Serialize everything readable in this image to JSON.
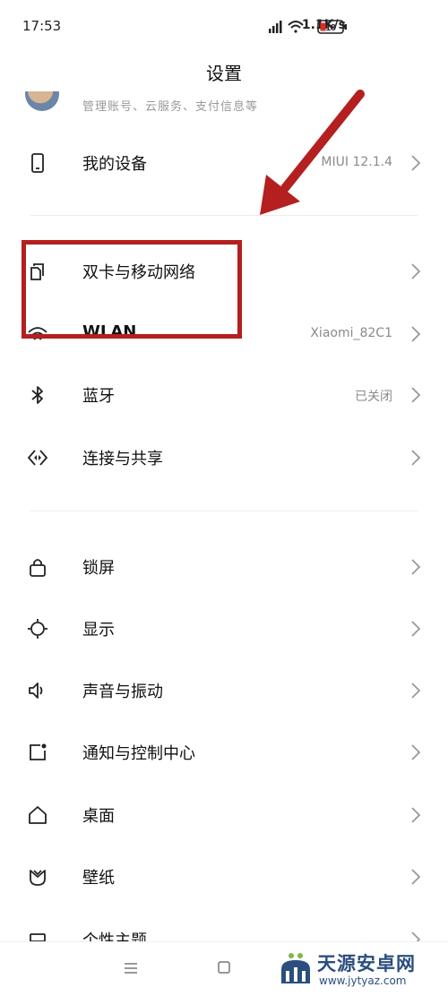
{
  "status": {
    "time": "17:53",
    "speed": "1.1K/s",
    "battery": "18"
  },
  "header": {
    "title": "设置"
  },
  "account": {
    "subtitle": "管理账号、云服务、支付信息等"
  },
  "rows": [
    {
      "label": "我的设备",
      "value": "MIUI 12.1.4",
      "icon": "phone-icon"
    },
    {
      "label": "双卡与移动网络",
      "value": "",
      "icon": "dual-sim-icon"
    },
    {
      "label": "WLAN",
      "value": "Xiaomi_82C1",
      "icon": "wifi-icon"
    },
    {
      "label": "蓝牙",
      "value": "已关闭",
      "icon": "bluetooth-icon"
    },
    {
      "label": "连接与共享",
      "value": "",
      "icon": "share-icon"
    },
    {
      "label": "锁屏",
      "value": "",
      "icon": "lock-icon"
    },
    {
      "label": "显示",
      "value": "",
      "icon": "display-icon"
    },
    {
      "label": "声音与振动",
      "value": "",
      "icon": "sound-icon"
    },
    {
      "label": "通知与控制中心",
      "value": "",
      "icon": "notification-icon"
    },
    {
      "label": "桌面",
      "value": "",
      "icon": "home-icon"
    },
    {
      "label": "壁纸",
      "value": "",
      "icon": "wallpaper-icon"
    },
    {
      "label": "个性主题",
      "value": "",
      "icon": "theme-icon"
    }
  ],
  "watermark": {
    "title": "天源安卓网",
    "url": "www.jytyaz.com"
  },
  "colors": {
    "highlight": "#b41f1f",
    "watermark": "#2b4e7e"
  }
}
